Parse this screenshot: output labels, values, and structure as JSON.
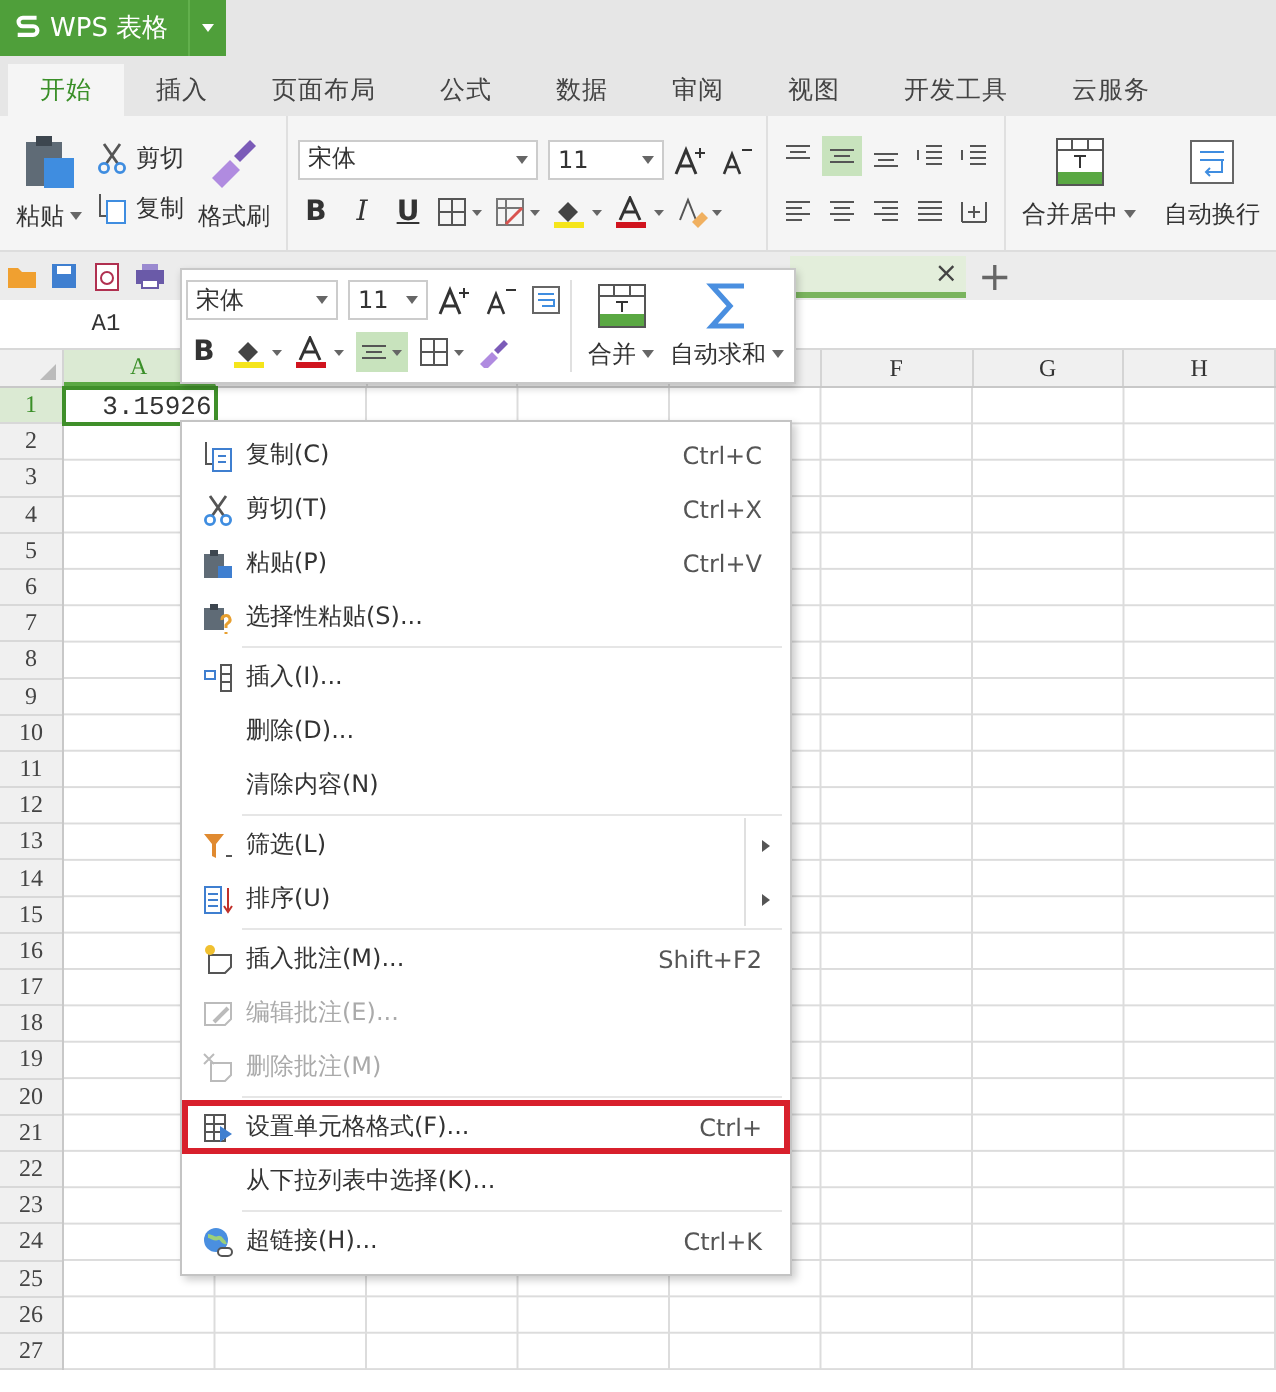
{
  "app": {
    "title": "WPS 表格"
  },
  "ribbon_tabs": [
    {
      "label": "开始",
      "selected": true
    },
    {
      "label": "插入",
      "selected": false
    },
    {
      "label": "页面布局",
      "selected": false
    },
    {
      "label": "公式",
      "selected": false
    },
    {
      "label": "数据",
      "selected": false
    },
    {
      "label": "审阅",
      "selected": false
    },
    {
      "label": "视图",
      "selected": false
    },
    {
      "label": "开发工具",
      "selected": false
    },
    {
      "label": "云服务",
      "selected": false
    }
  ],
  "ribbon": {
    "paste": "粘贴",
    "cut": "剪切",
    "copy": "复制",
    "format_painter": "格式刷",
    "font": "宋体",
    "font_size": "11",
    "bold": "B",
    "italic": "I",
    "underline": "U",
    "align_buttons": [
      {
        "selected": false
      },
      {
        "selected": true
      },
      {
        "selected": false
      },
      {
        "selected": false
      },
      {
        "selected": false
      },
      {
        "selected": false
      },
      {
        "selected": false
      },
      {
        "selected": false
      },
      {
        "selected": false
      },
      {
        "selected": false
      }
    ],
    "merge": "合并居中",
    "wrap": "自动换行"
  },
  "doc_tabs": {
    "close": "×",
    "new": "+"
  },
  "name_box": "A1",
  "sheet": {
    "columns": [
      {
        "label": "A",
        "selected": true
      },
      {},
      {},
      {},
      {},
      {
        "label": "F",
        "selected": false
      },
      {
        "label": "G",
        "selected": false
      },
      {
        "label": "H",
        "selected": false
      }
    ],
    "rows": [
      {
        "label": "1",
        "selected": true,
        "cells": [
          "3.15926"
        ]
      },
      {
        "label": "2",
        "selected": false
      },
      {
        "label": "3",
        "selected": false
      },
      {
        "label": "4",
        "selected": false
      },
      {
        "label": "5",
        "selected": false
      },
      {
        "label": "6",
        "selected": false
      },
      {
        "label": "7",
        "selected": false
      },
      {
        "label": "8",
        "selected": false
      },
      {
        "label": "9",
        "selected": false
      },
      {
        "label": "10",
        "selected": false
      },
      {
        "label": "11",
        "selected": false
      },
      {
        "label": "12",
        "selected": false
      },
      {
        "label": "13",
        "selected": false
      },
      {
        "label": "14",
        "selected": false
      },
      {
        "label": "15",
        "selected": false
      },
      {
        "label": "16",
        "selected": false
      },
      {
        "label": "17",
        "selected": false
      },
      {
        "label": "18",
        "selected": false
      },
      {
        "label": "19",
        "selected": false
      },
      {
        "label": "20",
        "selected": false
      },
      {
        "label": "21",
        "selected": false
      },
      {
        "label": "22",
        "selected": false
      },
      {
        "label": "23",
        "selected": false
      },
      {
        "label": "24",
        "selected": false
      },
      {
        "label": "25",
        "selected": false
      },
      {
        "label": "26",
        "selected": false
      },
      {
        "label": "27",
        "selected": false
      }
    ]
  },
  "mini_toolbar": {
    "font": "宋体",
    "font_size": "11",
    "bold": "B",
    "align_selected": true,
    "merge": "合并",
    "autosum": "自动求和"
  },
  "context_menu": {
    "sections": [
      [
        {
          "label": "复制(C)",
          "shortcut": "Ctrl+C",
          "disabled": false,
          "submenu": false,
          "highlighted": false
        },
        {
          "label": "剪切(T)",
          "shortcut": "Ctrl+X",
          "disabled": false,
          "submenu": false,
          "highlighted": false
        },
        {
          "label": "粘贴(P)",
          "shortcut": "Ctrl+V",
          "disabled": false,
          "submenu": false,
          "highlighted": false
        },
        {
          "label": "选择性粘贴(S)...",
          "disabled": false,
          "submenu": false,
          "highlighted": false
        }
      ],
      [
        {
          "label": "插入(I)...",
          "disabled": false,
          "submenu": false,
          "highlighted": false
        },
        {
          "label": "删除(D)...",
          "disabled": false,
          "submenu": false,
          "highlighted": false
        },
        {
          "label": "清除内容(N)",
          "disabled": false,
          "submenu": false,
          "highlighted": false
        }
      ],
      [
        {
          "label": "筛选(L)",
          "disabled": false,
          "submenu": true,
          "highlighted": false
        },
        {
          "label": "排序(U)",
          "disabled": false,
          "submenu": true,
          "highlighted": false
        }
      ],
      [
        {
          "label": "插入批注(M)...",
          "shortcut": "Shift+F2",
          "disabled": false,
          "submenu": false,
          "highlighted": false
        },
        {
          "label": "编辑批注(E)...",
          "disabled": true,
          "submenu": false,
          "highlighted": false
        },
        {
          "label": "删除批注(M)",
          "disabled": true,
          "submenu": false,
          "highlighted": false
        }
      ],
      [
        {
          "label": "设置单元格格式(F)...",
          "shortcut": "Ctrl+",
          "disabled": false,
          "submenu": false,
          "highlighted": true
        },
        {
          "label": "从下拉列表中选择(K)...",
          "disabled": false,
          "submenu": false,
          "highlighted": false
        }
      ],
      [
        {
          "label": "超链接(H)...",
          "shortcut": "Ctrl+K",
          "disabled": false,
          "submenu": false,
          "highlighted": false
        }
      ]
    ]
  }
}
